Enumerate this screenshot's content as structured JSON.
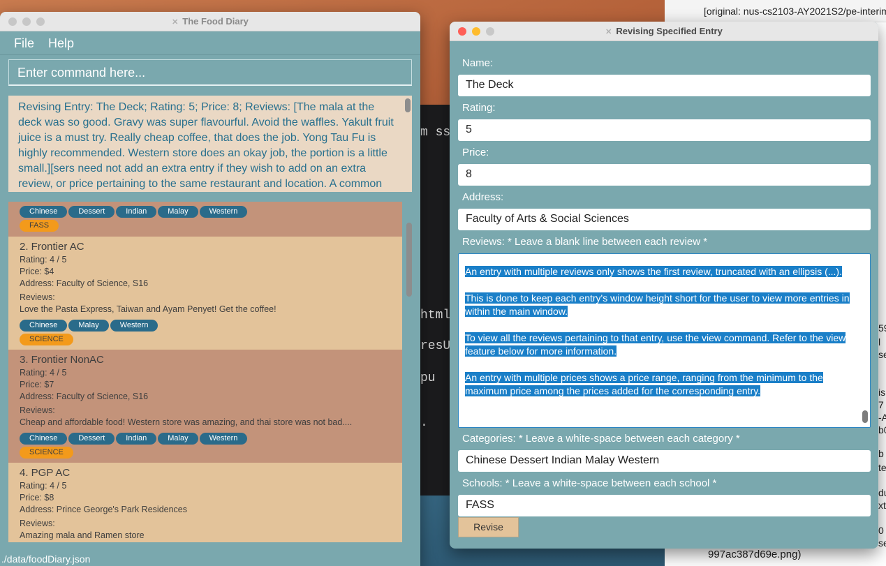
{
  "desktop": {
    "terminal_lines": [
      "m ss",
      "html",
      "resU",
      "pu ",
      "."
    ],
    "right_window": {
      "top_text": "[original: nus-cs2103-AY2021S2/pe-interim",
      "bottom_text": "997ac387d69e.png)",
      "fragments": [
        "59",
        "l",
        "se",
        "is",
        "7",
        "-A",
        "b0",
        "b",
        "te",
        "du",
        "xt",
        "0",
        "se"
      ]
    }
  },
  "main_window": {
    "title": "The Food Diary",
    "menu": [
      "File",
      "Help"
    ],
    "command_placeholder": "Enter command here...",
    "result_text": "Revising Entry: The Deck; Rating: 5; Price: 8; Reviews: [The mala at the deck was so good. Gravy was super flavourful. Avoid the waffles.  Yakult fruit juice is a must try. Really cheap coffee, that does the job. Yong Tau Fu is highly recommended. Western store does an okay job, the portion is a little small.][sers need not add an extra entry if they wish to add on an extra review, or price pertaining to the same restaurant and location. A common",
    "entries": [
      {
        "tags": [
          "Chinese",
          "Dessert",
          "Indian",
          "Malay",
          "Western"
        ],
        "school": "FASS"
      },
      {
        "name": "2.  Frontier AC",
        "rating": "Rating: 4 / 5",
        "price": "Price: $4",
        "address": "Address: Faculty of Science, S16",
        "reviews_label": "Reviews:",
        "review": "Love the Pasta Express, Taiwan and Ayam Penyet! Get the coffee!",
        "tags": [
          "Chinese",
          "Malay",
          "Western"
        ],
        "school": "SCIENCE"
      },
      {
        "name": "3.  Frontier NonAC",
        "rating": "Rating: 4 / 5",
        "price": "Price: $7",
        "address": "Address: Faculty of Science, S16",
        "reviews_label": "Reviews:",
        "review": "Cheap and affordable food! Western store was amazing, and thai store was not bad....",
        "tags": [
          "Chinese",
          "Dessert",
          "Indian",
          "Malay",
          "Western"
        ],
        "school": "SCIENCE"
      },
      {
        "name": "4.  PGP AC",
        "rating": "Rating: 4 / 5",
        "price": "Price: $8",
        "address": "Address: Prince George's Park Residences",
        "reviews_label": "Reviews:",
        "review": "Amazing mala and Ramen store"
      }
    ],
    "status": "./data/foodDiary.json"
  },
  "revise_window": {
    "title": "Revising Specified Entry",
    "name_label": "Name:",
    "name_value": "The Deck",
    "rating_label": "Rating:",
    "rating_value": "5",
    "price_label": "Price:",
    "price_value": "8",
    "address_label": "Address:",
    "address_value": "Faculty of Arts & Social Sciences",
    "reviews_label": "Reviews:   * Leave a blank line between each review *",
    "reviews": [
      "An entry with multiple reviews only shows the first review, truncated with an ellipsis (...).",
      "This is done to keep each entry's window height short for the user to view more entries in within the main window.",
      "To view all the reviews pertaining to that entry, use the view command. Refer to the view feature below for more information.",
      "An entry with multiple prices shows a price range, ranging from the minimum to the maximum price among the prices added for the corresponding entry."
    ],
    "categories_label": "Categories:    * Leave a white-space between each category *",
    "categories_value": "Chinese Dessert Indian Malay Western",
    "schools_label": "Schools:   * Leave a white-space between each school *",
    "schools_value": "FASS",
    "revise_button": "Revise"
  },
  "colors": {
    "window_bg": "#7aa8ae",
    "card_odd": "#c3937a",
    "card_even": "#e3c39a",
    "tag_blue": "#2a6b8a",
    "tag_orange": "#f39a1b",
    "selection": "#1a7fc8"
  }
}
